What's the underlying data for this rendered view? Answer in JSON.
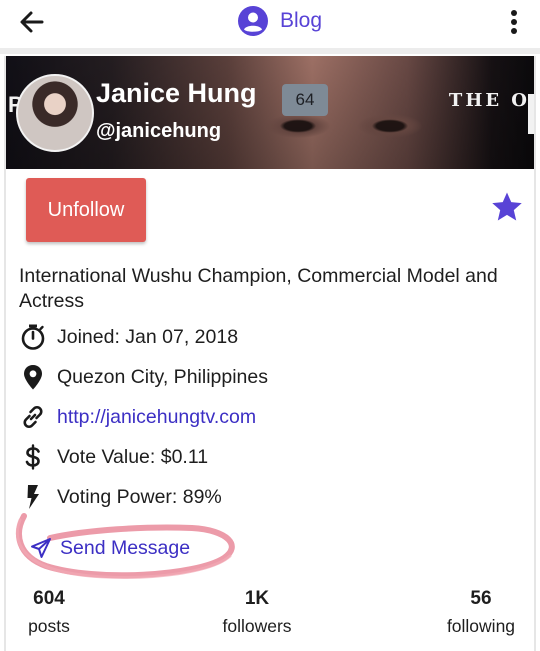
{
  "topbar": {
    "title": "Blog",
    "back_icon": "arrow-left-icon",
    "brand_icon": "account-circle-icon",
    "menu_icon": "more-vertical-icon"
  },
  "profile": {
    "display_name": "Janice Hung",
    "reputation": "64",
    "handle": "@janicehung",
    "cover_text": "THE O",
    "cover_letter": "P",
    "unfollow_label": "Unfollow",
    "bio": "International Wushu Champion, Commercial Model and Actress",
    "joined": "Joined: Jan 07, 2018",
    "location": "Quezon City, Philippines",
    "website": "http://janicehungtv.com",
    "vote_value": "Vote Value: $0.11",
    "voting_power": "Voting Power: 89%",
    "send_message_label": "Send Message"
  },
  "stats": [
    {
      "value": "604",
      "label": "posts"
    },
    {
      "value": "1K",
      "label": "followers"
    },
    {
      "value": "56",
      "label": "following"
    }
  ],
  "colors": {
    "accent": "#5843d6",
    "link": "#3c2fc4",
    "unfollow": "#df5b56",
    "badge": "#7e8a96",
    "annotation": "#e9899a"
  }
}
